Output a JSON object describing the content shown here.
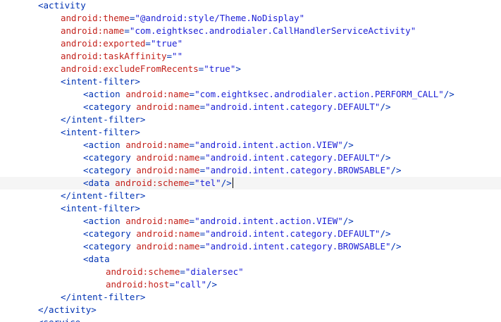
{
  "editor": {
    "lines": [
      {
        "indent": 1,
        "tokens": [
          {
            "t": "tag",
            "v": "<activity"
          }
        ]
      },
      {
        "indent": 2,
        "tokens": [
          {
            "t": "attr",
            "v": "android:theme"
          },
          {
            "t": "eq",
            "v": "="
          },
          {
            "t": "val",
            "v": "\"@android:style/Theme.NoDisplay\""
          }
        ]
      },
      {
        "indent": 2,
        "tokens": [
          {
            "t": "attr",
            "v": "android:name"
          },
          {
            "t": "eq",
            "v": "="
          },
          {
            "t": "val",
            "v": "\"com.eightksec.androdialer.CallHandlerServiceActivity\""
          }
        ]
      },
      {
        "indent": 2,
        "tokens": [
          {
            "t": "attr",
            "v": "android:exported"
          },
          {
            "t": "eq",
            "v": "="
          },
          {
            "t": "val",
            "v": "\"true\""
          }
        ]
      },
      {
        "indent": 2,
        "tokens": [
          {
            "t": "attr",
            "v": "android:taskAffinity"
          },
          {
            "t": "eq",
            "v": "="
          },
          {
            "t": "val",
            "v": "\"\""
          }
        ]
      },
      {
        "indent": 2,
        "tokens": [
          {
            "t": "attr",
            "v": "android:excludeFromRecents"
          },
          {
            "t": "eq",
            "v": "="
          },
          {
            "t": "val",
            "v": "\"true\""
          },
          {
            "t": "tag",
            "v": ">"
          }
        ]
      },
      {
        "indent": 2,
        "tokens": [
          {
            "t": "tag",
            "v": "<intent-filter>"
          }
        ]
      },
      {
        "indent": 3,
        "tokens": [
          {
            "t": "tag",
            "v": "<action "
          },
          {
            "t": "attr",
            "v": "android:name"
          },
          {
            "t": "eq",
            "v": "="
          },
          {
            "t": "val",
            "v": "\"com.eightksec.androdialer.action.PERFORM_CALL\""
          },
          {
            "t": "tag",
            "v": "/>"
          }
        ]
      },
      {
        "indent": 3,
        "tokens": [
          {
            "t": "tag",
            "v": "<category "
          },
          {
            "t": "attr",
            "v": "android:name"
          },
          {
            "t": "eq",
            "v": "="
          },
          {
            "t": "val",
            "v": "\"android.intent.category.DEFAULT\""
          },
          {
            "t": "tag",
            "v": "/>"
          }
        ]
      },
      {
        "indent": 2,
        "tokens": [
          {
            "t": "tag",
            "v": "</intent-filter>"
          }
        ]
      },
      {
        "indent": 2,
        "tokens": [
          {
            "t": "tag",
            "v": "<intent-filter>"
          }
        ]
      },
      {
        "indent": 3,
        "tokens": [
          {
            "t": "tag",
            "v": "<action "
          },
          {
            "t": "attr",
            "v": "android:name"
          },
          {
            "t": "eq",
            "v": "="
          },
          {
            "t": "val",
            "v": "\"android.intent.action.VIEW\""
          },
          {
            "t": "tag",
            "v": "/>"
          }
        ]
      },
      {
        "indent": 3,
        "tokens": [
          {
            "t": "tag",
            "v": "<category "
          },
          {
            "t": "attr",
            "v": "android:name"
          },
          {
            "t": "eq",
            "v": "="
          },
          {
            "t": "val",
            "v": "\"android.intent.category.DEFAULT\""
          },
          {
            "t": "tag",
            "v": "/>"
          }
        ]
      },
      {
        "indent": 3,
        "tokens": [
          {
            "t": "tag",
            "v": "<category "
          },
          {
            "t": "attr",
            "v": "android:name"
          },
          {
            "t": "eq",
            "v": "="
          },
          {
            "t": "val",
            "v": "\"android.intent.category.BROWSABLE\""
          },
          {
            "t": "tag",
            "v": "/>"
          }
        ]
      },
      {
        "indent": 3,
        "current": true,
        "caret": true,
        "tokens": [
          {
            "t": "tag",
            "v": "<data "
          },
          {
            "t": "attr",
            "v": "android:scheme"
          },
          {
            "t": "eq",
            "v": "="
          },
          {
            "t": "val",
            "v": "\"tel\""
          },
          {
            "t": "tag",
            "v": "/>"
          }
        ]
      },
      {
        "indent": 2,
        "tokens": [
          {
            "t": "tag",
            "v": "</intent-filter>"
          }
        ]
      },
      {
        "indent": 2,
        "tokens": [
          {
            "t": "tag",
            "v": "<intent-filter>"
          }
        ]
      },
      {
        "indent": 3,
        "tokens": [
          {
            "t": "tag",
            "v": "<action "
          },
          {
            "t": "attr",
            "v": "android:name"
          },
          {
            "t": "eq",
            "v": "="
          },
          {
            "t": "val",
            "v": "\"android.intent.action.VIEW\""
          },
          {
            "t": "tag",
            "v": "/>"
          }
        ]
      },
      {
        "indent": 3,
        "tokens": [
          {
            "t": "tag",
            "v": "<category "
          },
          {
            "t": "attr",
            "v": "android:name"
          },
          {
            "t": "eq",
            "v": "="
          },
          {
            "t": "val",
            "v": "\"android.intent.category.DEFAULT\""
          },
          {
            "t": "tag",
            "v": "/>"
          }
        ]
      },
      {
        "indent": 3,
        "tokens": [
          {
            "t": "tag",
            "v": "<category "
          },
          {
            "t": "attr",
            "v": "android:name"
          },
          {
            "t": "eq",
            "v": "="
          },
          {
            "t": "val",
            "v": "\"android.intent.category.BROWSABLE\""
          },
          {
            "t": "tag",
            "v": "/>"
          }
        ]
      },
      {
        "indent": 3,
        "tokens": [
          {
            "t": "tag",
            "v": "<data"
          }
        ]
      },
      {
        "indent": 4,
        "tokens": [
          {
            "t": "attr",
            "v": "android:scheme"
          },
          {
            "t": "eq",
            "v": "="
          },
          {
            "t": "val",
            "v": "\"dialersec\""
          }
        ]
      },
      {
        "indent": 4,
        "tokens": [
          {
            "t": "attr",
            "v": "android:host"
          },
          {
            "t": "eq",
            "v": "="
          },
          {
            "t": "val",
            "v": "\"call\""
          },
          {
            "t": "tag",
            "v": "/>"
          }
        ]
      },
      {
        "indent": 2,
        "tokens": [
          {
            "t": "tag",
            "v": "</intent-filter>"
          }
        ]
      },
      {
        "indent": 1,
        "tokens": [
          {
            "t": "tag",
            "v": "</activity>"
          }
        ]
      },
      {
        "indent": 1,
        "tokens": [
          {
            "t": "tag",
            "v": "<service"
          }
        ]
      }
    ]
  }
}
